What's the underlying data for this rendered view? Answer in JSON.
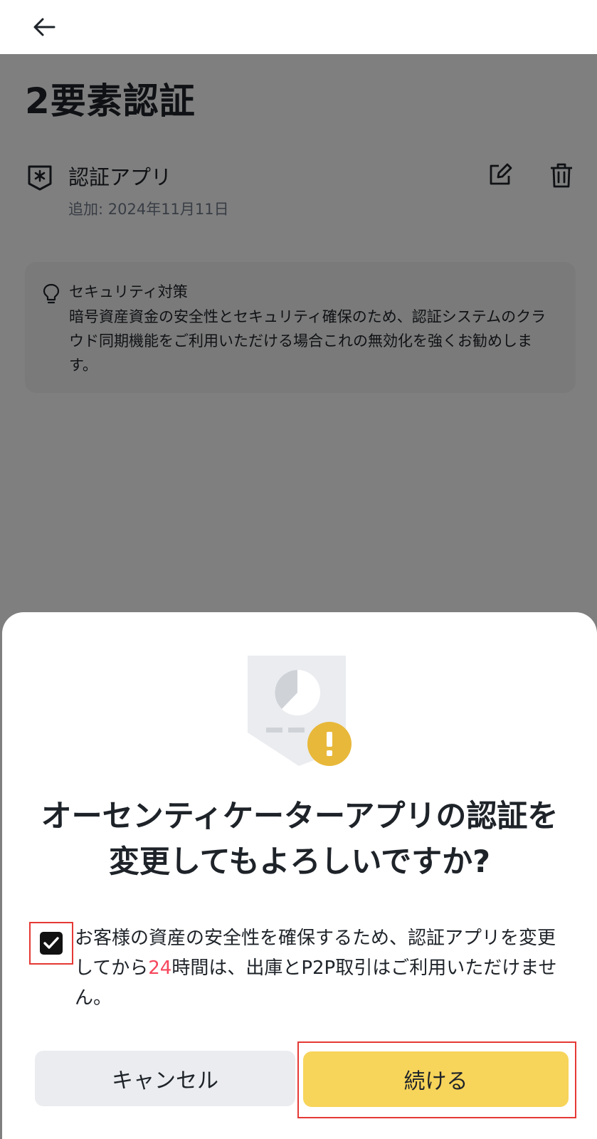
{
  "page": {
    "title": "2要素認証"
  },
  "auth_method": {
    "name": "認証アプリ",
    "added": "追加: 2024年11月11日"
  },
  "tip": {
    "title": "セキュリティ対策",
    "body": "暗号資産資金の安全性とセキュリティ確保のため、認証システムのクラウド同期機能をご利用いただける場合これの無効化を強くお勧めします。"
  },
  "dialog": {
    "title": "オーセンティケーターアプリの認証を変更してもよろしいですか?",
    "agree_before": "お客様の資産の安全性を確保するため、認証アプリを変更してから",
    "agree_hours": "24",
    "agree_after": "時間は、出庫とP2P取引はご利用いただけません。",
    "checkbox_checked": true,
    "cancel_label": "キャンセル",
    "continue_label": "続ける"
  },
  "colors": {
    "accent": "#f7d45a",
    "highlight": "#f6465d",
    "warning_badge": "#e8b83a",
    "annotation_frame": "#e53935"
  },
  "icons": [
    "back-arrow-icon",
    "shield-asterisk-icon",
    "edit-icon",
    "trash-icon",
    "lightbulb-icon",
    "checkmark-icon",
    "warning-document-illustration"
  ]
}
